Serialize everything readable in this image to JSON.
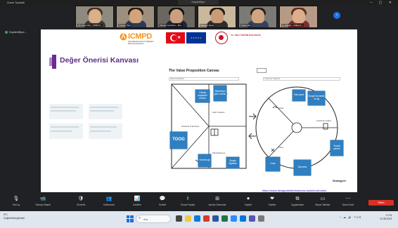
{
  "window": {
    "title": "Zoom Toplantı",
    "recording": "Kaydediliyor",
    "controls": "– ▢ ✕"
  },
  "participants": [
    {
      "name": "IIIC Arlen Ulu... ICMP N...",
      "bg": "#8f8a7f",
      "face": "#d9b08c",
      "shirt": "#3a3a3a",
      "hair": "#4a3020"
    },
    {
      "name": "Tuncay Özer",
      "bg": "#9d8f7d",
      "face": "#d2a47e",
      "shirt": "#2b3a55",
      "hair": "#2a1a12"
    },
    {
      "name": "Muhammed Eme... Ba...",
      "bg": "#6b6660",
      "face": "#caa080",
      "shirt": "#1e2633",
      "hair": "#1a120c"
    },
    {
      "name": "Bahtiyar Akyol",
      "bg": "#c9b89c",
      "face": "#c99c78",
      "shirt": "#2d2d2d",
      "hair": "#211812"
    },
    {
      "name": "Yasin Akin",
      "bg": "#7c7a76",
      "face": "#d0a583",
      "shirt": "#34435a",
      "hair": "#2b1e16"
    },
    {
      "name": "Ş. Gülşah... Gülay K...",
      "bg": "#b59a86",
      "face": "#dcae8c",
      "shirt": "#7a2e2e",
      "hair": "#5a2f1c"
    }
  ],
  "sharer": "Kaydediliyor...",
  "slide": {
    "title": "Değer Önerisi Kanvası",
    "icmpd": {
      "logo": "ICMPD",
      "subtitle": "International Centre for Migration Policy Development"
    },
    "ministry": "T.C. MİLLÎ EĞİTİM BAKANLIĞI",
    "canvas": {
      "title": "The Value Proposition Canvas",
      "field_left": "Value Proposition",
      "field_right": "Customer Segment",
      "labels": {
        "gain_creators": "Gain Creators",
        "products": "Products & Services",
        "pain_relievers": "Pain Relievers",
        "gains": "Gains",
        "customer_jobs": "Customer Job(s)",
        "pains": "Pains"
      },
      "stickies": [
        {
          "key": "s1",
          "text": "Yüksek kapasiteli ürünler"
        },
        {
          "key": "s2",
          "text": "Beklentiye göre hizmet"
        },
        {
          "key": "s3",
          "text": "TOOG"
        },
        {
          "key": "s4",
          "text": "Hizmet ağı"
        },
        {
          "key": "s5",
          "text": "Sosyal faydalar"
        },
        {
          "key": "s6",
          "text": "Fark yarat"
        },
        {
          "key": "s7",
          "text": "Sosyal hizmetler ve ağ"
        },
        {
          "key": "s8",
          "text": "Sosyal yardım"
        },
        {
          "key": "s9",
          "text": "Gıda"
        },
        {
          "key": "s10",
          "text": "Barınma"
        }
      ],
      "brand": "Strategyzer"
    },
    "url": "https://www.designabetterbusiness.tools/tools/value"
  },
  "toolbar": {
    "items": [
      {
        "icon": "🎙",
        "label": "Sesi aç"
      },
      {
        "icon": "📹",
        "label": "Videoyu Başlat"
      },
      {
        "icon": "🛡",
        "label": "Güvenlik"
      },
      {
        "icon": "👥",
        "label": "Katılımcılar"
      },
      {
        "icon": "📊",
        "label": "Anketler"
      },
      {
        "icon": "💬",
        "label": "Sohbet"
      },
      {
        "icon": "⬆",
        "label": "Ekranı Paylaş"
      },
      {
        "icon": "⊞",
        "label": "Ayrılan Oturumlar"
      },
      {
        "icon": "⏺",
        "label": "Kaydet"
      },
      {
        "icon": "❤",
        "label": "Tepkiler"
      },
      {
        "icon": "⧉",
        "label": "Uygulamalar"
      },
      {
        "icon": "▭",
        "label": "Beyaz Tahtalar"
      },
      {
        "icon": "⋯",
        "label": "Daha Fazla"
      }
    ],
    "end": "Bitirin"
  },
  "taskbar": {
    "weather": "9°C\nÇoğunlukla güneşli",
    "search": "Ara",
    "tray": "^ ☁ 🔊 TUR",
    "time": "17:01",
    "date": "12.08.2021"
  }
}
